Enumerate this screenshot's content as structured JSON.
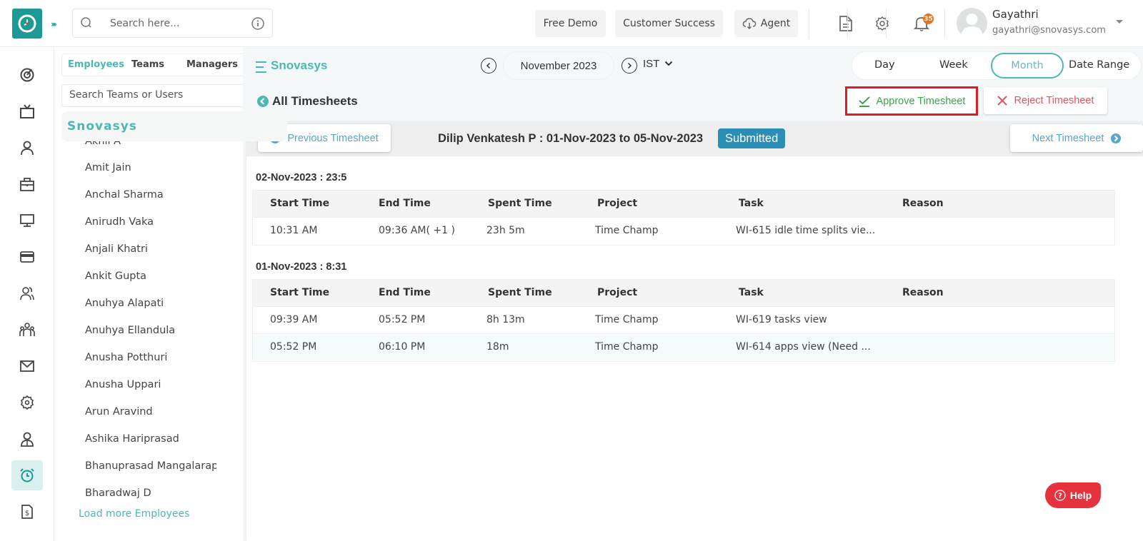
{
  "header": {
    "search_placeholder": "Search here...",
    "buttons": {
      "free_demo": "Free Demo",
      "customer_success": "Customer Success",
      "agent": "Agent"
    },
    "notification_count": "35",
    "user": {
      "name": "Gayathri",
      "email": "gayathri@snovasys.com"
    }
  },
  "left_nav": {
    "items": [
      {
        "icon": "dashboard-icon"
      },
      {
        "icon": "tv-icon"
      },
      {
        "icon": "user-icon"
      },
      {
        "icon": "briefcase-icon"
      },
      {
        "icon": "monitor-icon"
      },
      {
        "icon": "card-icon"
      },
      {
        "icon": "users-icon"
      },
      {
        "icon": "team-icon"
      },
      {
        "icon": "mail-icon"
      },
      {
        "icon": "settings-icon"
      },
      {
        "icon": "employee-icon"
      },
      {
        "icon": "alarm-clock-icon",
        "active": true
      },
      {
        "icon": "invoice-icon"
      }
    ]
  },
  "panel": {
    "tabs": [
      {
        "label": "Employees",
        "active": true
      },
      {
        "label": "Teams"
      },
      {
        "label": "Managers"
      }
    ],
    "search_placeholder": "Search Teams or Users",
    "org_name": "Snovasys",
    "employees": [
      "Akhil A",
      "Amit Jain",
      "Anchal Sharma",
      "Anirudh Vaka",
      "Anjali Khatri",
      "Ankit Gupta",
      "Anuhya Alapati",
      "Anuhya Ellandula",
      "Anusha Potthuri",
      "Anusha Uppari",
      "Arun Aravind",
      "Ashika Hariprasad",
      "Bhanuprasad Mangalarapu",
      "Bharadwaj D"
    ],
    "load_more": "Load more Employees"
  },
  "main": {
    "title": "Snovasys",
    "month": "November 2023",
    "timezone": "IST",
    "range_tabs": [
      {
        "label": "Day"
      },
      {
        "label": "Week"
      },
      {
        "label": "Month",
        "active": true
      },
      {
        "label": "Date Range"
      }
    ],
    "back_label": "All Timesheets",
    "approve_label": "Approve Timesheet",
    "reject_label": "Reject Timesheet",
    "prev_label": "Previous Timesheet",
    "next_label": "Next Timesheet",
    "timesheet_info": "Dilip Venkatesh P : 01-Nov-2023 to 05-Nov-2023",
    "status": "Submitted",
    "columns": [
      "Start Time",
      "End Time",
      "Spent Time",
      "Project",
      "Task",
      "Reason"
    ],
    "days": [
      {
        "heading": "02-Nov-2023 : 23:5",
        "rows": [
          {
            "start": "10:31 AM",
            "end": "09:36 AM( +1 )",
            "spent": "23h 5m",
            "project": "Time Champ",
            "task": "WI-615 idle time splits vie...",
            "reason": ""
          }
        ]
      },
      {
        "heading": "01-Nov-2023 : 8:31",
        "rows": [
          {
            "start": "09:39 AM",
            "end": "05:52 PM",
            "spent": "8h 13m",
            "project": "Time Champ",
            "task": "WI-619 tasks view",
            "reason": ""
          },
          {
            "start": "05:52 PM",
            "end": "06:10 PM",
            "spent": "18m",
            "project": "Time Champ",
            "task": "WI-614 apps view (Need ...",
            "reason": ""
          }
        ]
      }
    ]
  },
  "help_label": "Help",
  "colors": {
    "brand": "#1e9a96",
    "accent": "#4db8b3",
    "approve": "#3aa54a",
    "reject": "#e0555c",
    "status": "#2a8fb7",
    "help": "#e5323c",
    "highlight_border": "#e01b24"
  }
}
